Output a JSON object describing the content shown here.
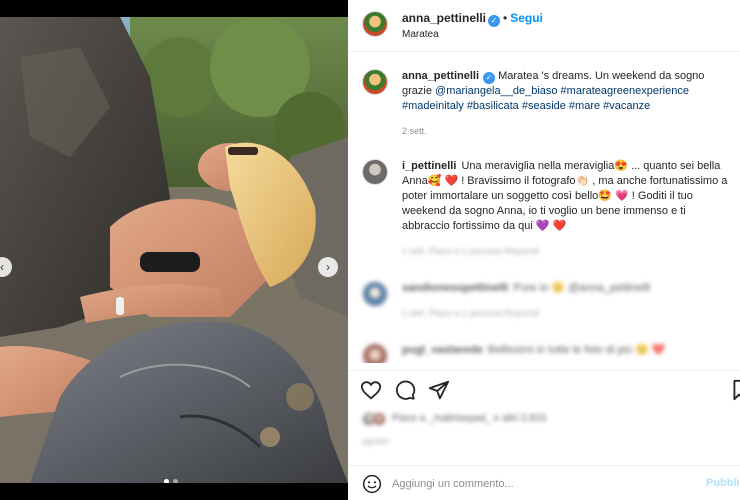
{
  "post": {
    "username": "anna_pettinelli",
    "follow_label": "Segui",
    "separator": "•",
    "location": "Maratea",
    "caption_text": "Maratea 's dreams. Un weekend da sogno grazie",
    "caption_tags": "@mariangela__de_biaso #marateagreenexperience #madeinitaly #basilicata #seaside #mare #vacanze",
    "caption_time": "2 sett.",
    "date": "agosto",
    "likes_text": "Piace a _maletaspad_ e altri 2.823"
  },
  "comments": [
    {
      "username": "i_pettinelli",
      "text": "Una meraviglia nella meraviglia😍 ... quanto sei bella Anna🥰 ❤️ ! Bravissimo il fotografo👏🏻 , ma anche fortunatissimo a poter immortalare un soggetto così bello🤩 💗 ! Goditi il tuo weekend da sogno Anna, io ti voglio un bene immenso e ti abbraccio fortissimo da qui 💜 ❤️",
      "meta": "1 sett.   Piace a 1 persona   Rispondi"
    },
    {
      "username": "sandionesopettinelli",
      "text": "Pure io 😊 @anna_pettinelli",
      "meta": "1 sett.   Piace a 1 persona   Rispondi"
    },
    {
      "username": "pugl_vastarede",
      "text": "Bellissimi in tutte le foto di più 😊 ❤️",
      "meta": ""
    }
  ],
  "add_comment": {
    "placeholder": "Aggiungi un commento...",
    "publish_label": "Pubblica"
  },
  "icons": {
    "like": "heart-icon",
    "comment": "comment-icon",
    "share": "send-icon",
    "save": "bookmark-icon",
    "emoji": "emoji-icon",
    "verified": "verified-badge-icon"
  },
  "colors": {
    "link": "#0095f6",
    "tag": "#00376b",
    "muted": "#8e8e8e",
    "verified": "#3897f0"
  }
}
